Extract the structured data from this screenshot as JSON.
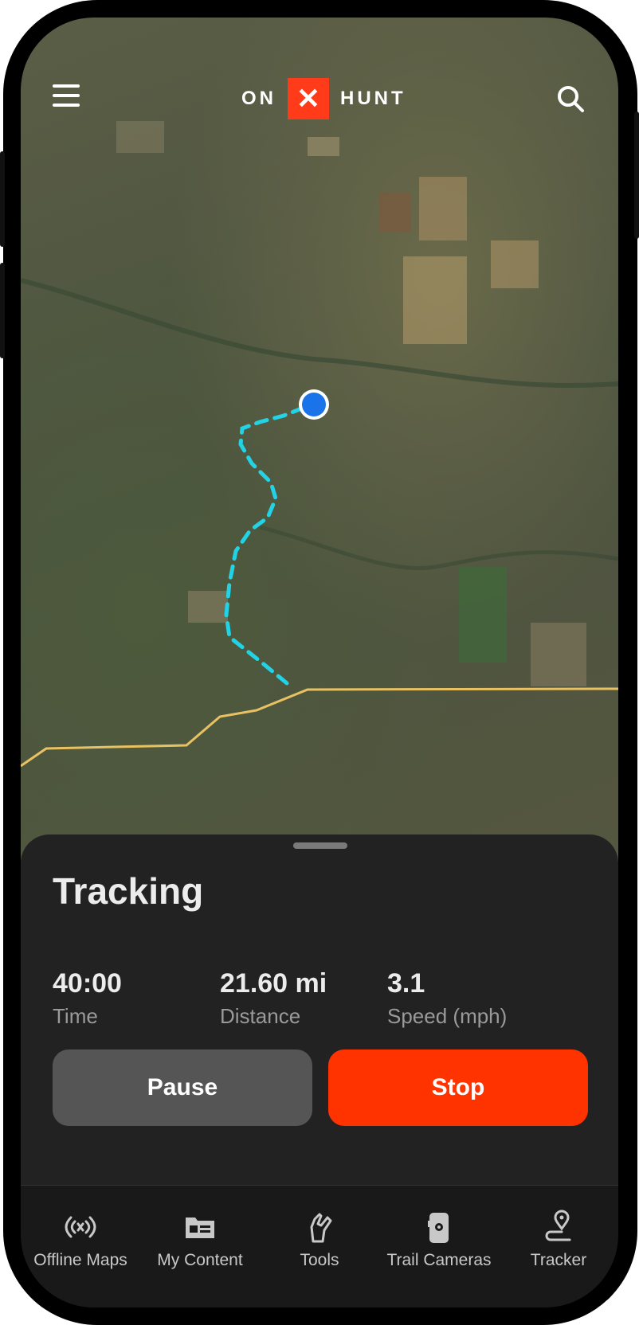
{
  "header": {
    "logo_left": "ON",
    "logo_mark": "✕",
    "logo_right": "HUNT",
    "menu_icon": "hamburger-menu-icon",
    "search_icon": "search-icon"
  },
  "map": {
    "track_color": "#22d3e6",
    "road_color": "#e8c162",
    "location_color": "#1a73e8"
  },
  "tracking": {
    "title": "Tracking",
    "stats": [
      {
        "value": "40:00",
        "label": "Time"
      },
      {
        "value": "21.60 mi",
        "label": "Distance"
      },
      {
        "value": "3.1",
        "label": "Speed (mph)"
      }
    ],
    "pause_label": "Pause",
    "stop_label": "Stop",
    "stop_color": "#ff3300"
  },
  "nav": {
    "items": [
      {
        "label": "Offline Maps",
        "icon": "offline-signal-icon"
      },
      {
        "label": "My Content",
        "icon": "folder-card-icon"
      },
      {
        "label": "Tools",
        "icon": "multitool-icon"
      },
      {
        "label": "Trail Cameras",
        "icon": "trail-camera-icon"
      },
      {
        "label": "Tracker",
        "icon": "location-pin-path-icon"
      }
    ]
  }
}
